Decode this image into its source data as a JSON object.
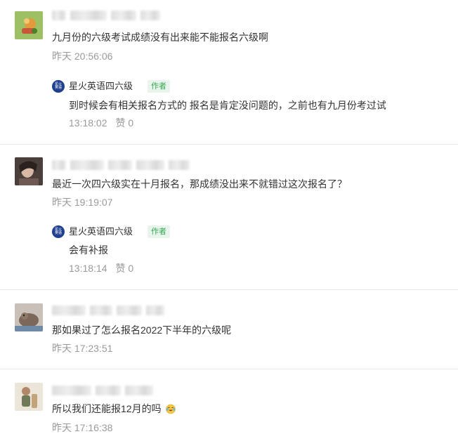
{
  "comments": [
    {
      "text": "九月份的六级考试成绩没有出来能不能报名六级啊",
      "time": "昨天 20:56:06",
      "reply": {
        "author": "星火英语四六级",
        "badge": "作者",
        "logo_text": "星火英语",
        "text": "到时候会有相关报名方式的 报名是肯定没问题的，之前也有九月份考过试",
        "time": "13:18:02",
        "likes": "赞 0"
      }
    },
    {
      "text": "最近一次四六级实在十月报名，那成绩没出来不就错过这次报名了？",
      "time": "昨天 19:19:07",
      "reply": {
        "author": "星火英语四六级",
        "badge": "作者",
        "logo_text": "星火英语",
        "text": "会有补报",
        "time": "13:18:14",
        "likes": "赞 0"
      }
    },
    {
      "text": "那如果过了怎么报名2022下半年的六级呢",
      "time": "昨天 17:23:51"
    },
    {
      "text": "所以我们还能报12月的吗",
      "emoji": "crying-laughing-emoji",
      "time": "昨天 17:16:38"
    }
  ],
  "colors": {
    "meta_gray": "#9a9a9a",
    "badge_green": "#33a952",
    "badge_bg": "#e9f5ec",
    "logo_blue": "#1f3f8f",
    "divider": "#e9e9e9"
  }
}
